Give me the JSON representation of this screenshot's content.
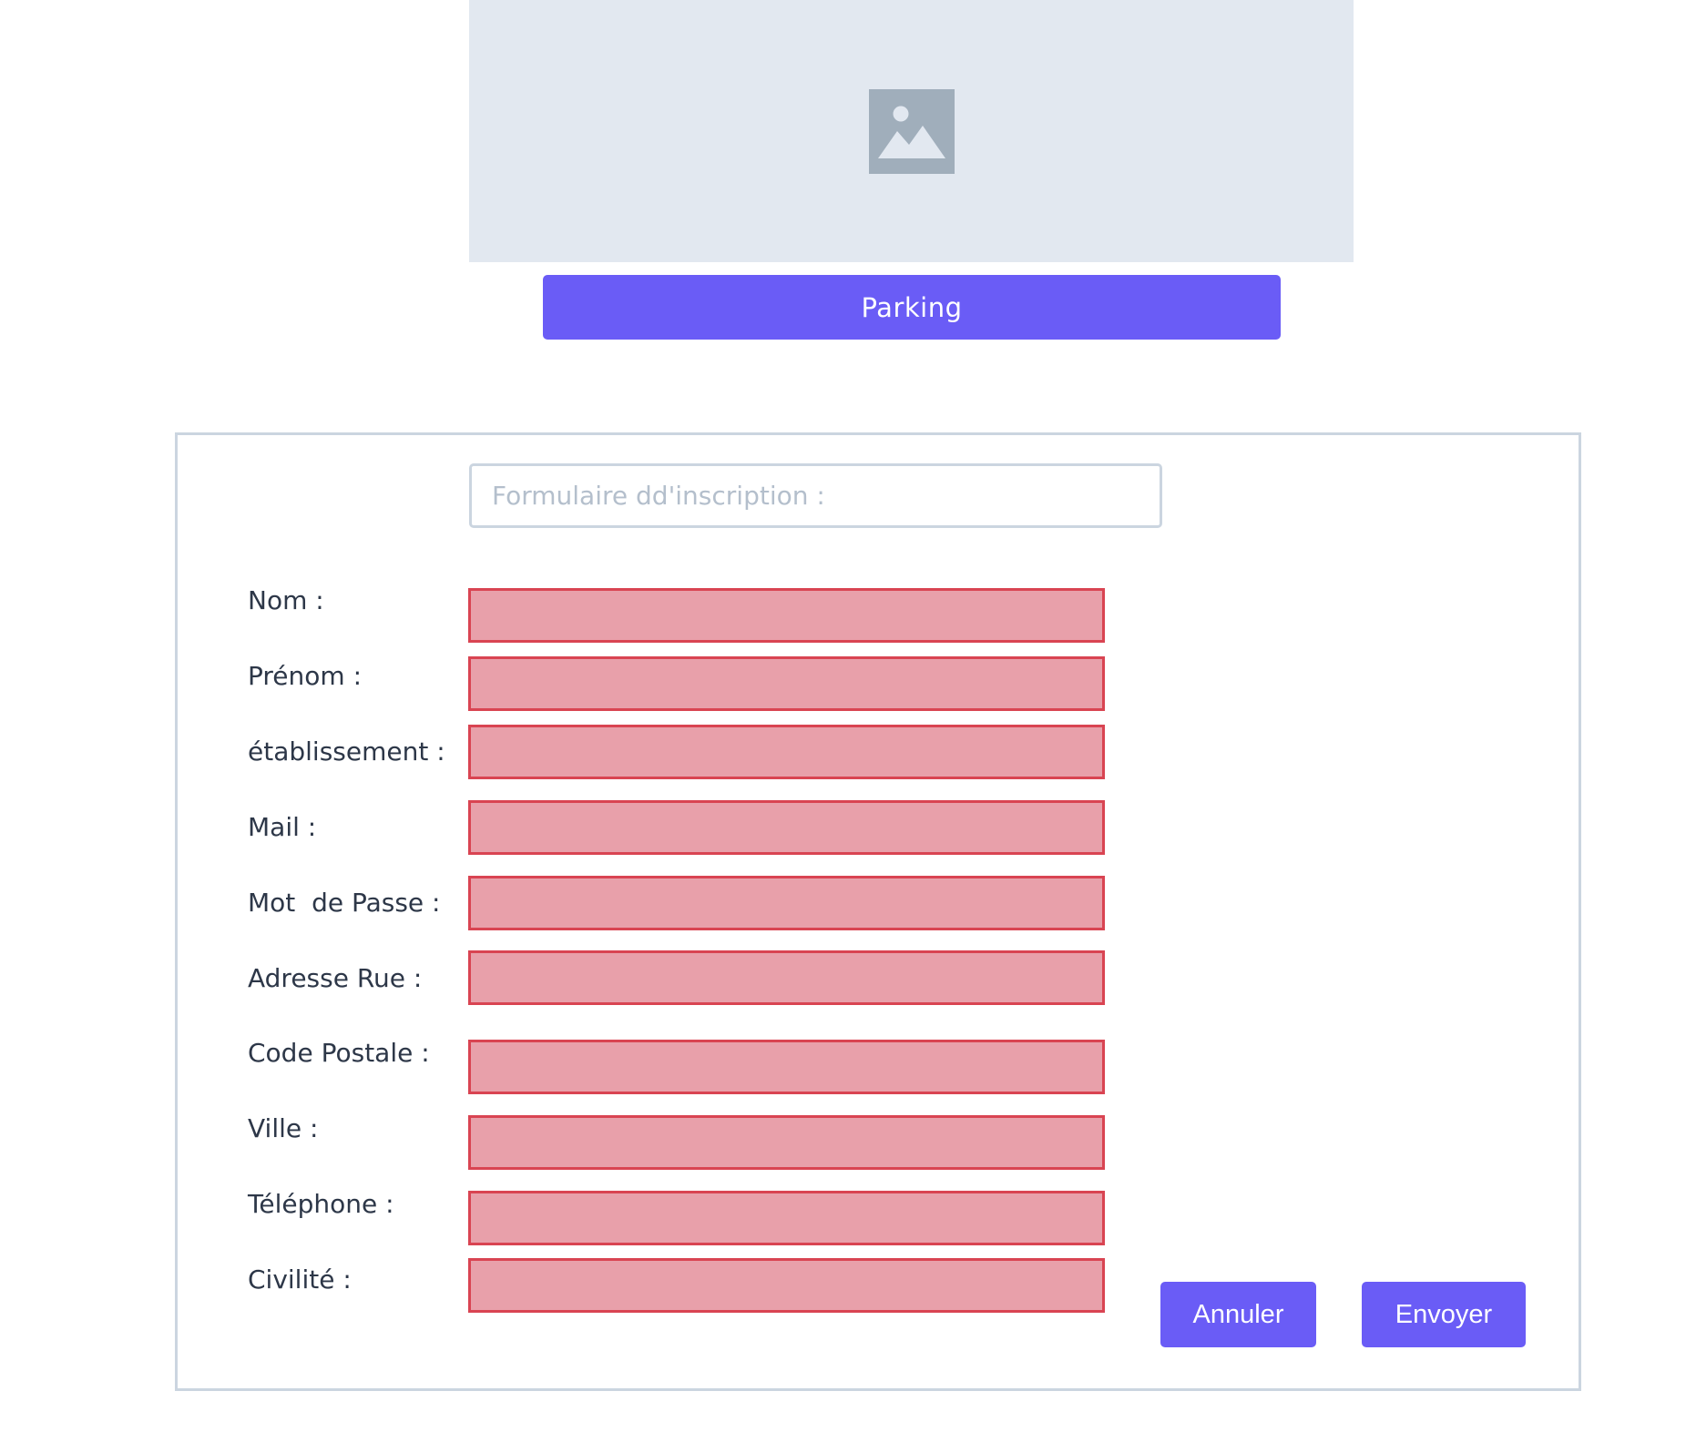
{
  "header": {
    "image_icon": "image-placeholder-icon",
    "parking_label": "Parking"
  },
  "form": {
    "title_placeholder": "Formulaire dd'inscription :",
    "fields": [
      {
        "label": "Nom :",
        "value": ""
      },
      {
        "label": "Prénom :",
        "value": ""
      },
      {
        "label": "établissement :",
        "value": ""
      },
      {
        "label": "Mail :",
        "value": ""
      },
      {
        "label": "Mot  de Passe :",
        "value": ""
      },
      {
        "label": "Adresse Rue :",
        "value": ""
      },
      {
        "label": "Code Postale :",
        "value": ""
      },
      {
        "label": "Ville :",
        "value": ""
      },
      {
        "label": "Téléphone :",
        "value": ""
      },
      {
        "label": "Civilité :",
        "value": ""
      }
    ],
    "cancel_label": "Annuler",
    "submit_label": "Envoyer"
  },
  "colors": {
    "accent": "#6a5cf6",
    "field_fill": "#e8a0aa",
    "field_border": "#d94452",
    "placeholder_bg": "#e2e8f0",
    "panel_border": "#cbd5e0"
  }
}
